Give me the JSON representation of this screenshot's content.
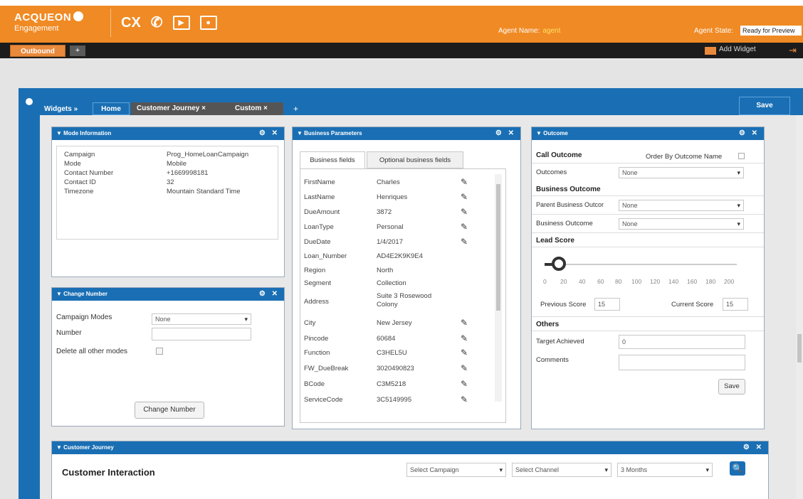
{
  "header": {
    "logo_line1": "ACQUEON",
    "logo_line2": "Engagement",
    "cx_label": "CX",
    "agent_name_label": "Agent Name:",
    "agent_name_value": "agent",
    "agent_state_label": "Agent State:",
    "agent_state_value": "Ready for Preview"
  },
  "tabbar": {
    "active_tab": "Outbound",
    "add_tab": "+",
    "add_widget": "Add Widget"
  },
  "widgets_bar": {
    "label": "Widgets »",
    "tabs": [
      {
        "label": "Home"
      },
      {
        "label": "Customer Journey ×"
      },
      {
        "label": "Custom ×"
      }
    ],
    "plus": "+",
    "save": "Save"
  },
  "mode_info": {
    "title": "▼ Mode Information",
    "controls": "⚙ ✕",
    "rows": [
      {
        "key": "Campaign",
        "value": "Prog_HomeLoanCampaign"
      },
      {
        "key": "Mode",
        "value": "Mobile"
      },
      {
        "key": "Contact Number",
        "value": "+1669998181"
      },
      {
        "key": "Contact ID",
        "value": "32"
      },
      {
        "key": "Timezone",
        "value": "Mountain Standard Time"
      }
    ]
  },
  "change_number": {
    "title": "▼ Change Number",
    "controls": "⚙ ✕",
    "campaign_modes_label": "Campaign Modes",
    "campaign_modes_value": "None",
    "number_label": "Number",
    "number_value": "",
    "delete_label": "Delete all other modes",
    "button": "Change Number"
  },
  "business_params": {
    "title": "▼ Business Parameters",
    "controls": "⚙ ✕",
    "tab1": "Business fields",
    "tab2": "Optional business fields",
    "rows": [
      {
        "key": "FirstName",
        "value": "Charles",
        "edit": "✎"
      },
      {
        "key": "LastName",
        "value": "Henriques",
        "edit": "✎"
      },
      {
        "key": "DueAmount",
        "value": "3872",
        "edit": "✎"
      },
      {
        "key": "LoanType",
        "value": "Personal",
        "edit": "✎"
      },
      {
        "key": "DueDate",
        "value": "1/4/2017",
        "edit": "✎"
      },
      {
        "key": "Loan_Number",
        "value": "AD4E2K9K9E4",
        "edit": ""
      },
      {
        "key": "Region",
        "value": "North",
        "edit": ""
      },
      {
        "key": "Segment",
        "value": "Collection",
        "edit": ""
      },
      {
        "key": "Address",
        "value": "Suite 3 Rosewood Colony",
        "edit": ""
      },
      {
        "key": "City",
        "value": "New Jersey",
        "edit": "✎"
      },
      {
        "key": "Pincode",
        "value": "60684",
        "edit": "✎"
      },
      {
        "key": "Function",
        "value": "C3HEL5U",
        "edit": "✎"
      },
      {
        "key": "FW_DueBreak",
        "value": "3020490823",
        "edit": "✎"
      },
      {
        "key": "BCode",
        "value": "C3M5218",
        "edit": "✎"
      },
      {
        "key": "ServiceCode",
        "value": "3C5149995",
        "edit": "✎"
      }
    ]
  },
  "outcome": {
    "title": "▼ Outcome",
    "controls": "⚙ ✕",
    "call_outcome": "Call Outcome",
    "order_by": "Order By Outcome Name",
    "outcomes_label": "Outcomes",
    "outcomes_value": "None",
    "business_outcome": "Business Outcome",
    "parent_label": "Parent Business Outcor",
    "parent_value": "None",
    "bo_label": "Business Outcome",
    "bo_value": "None",
    "lead_score": "Lead Score",
    "lead_score_value": 0.02,
    "ticks": [
      "0",
      "20",
      "40",
      "60",
      "80",
      "100",
      "120",
      "140",
      "160",
      "180",
      "200"
    ],
    "previous_score_label": "Previous Score",
    "previous_score_value": "15",
    "current_score_label": "Current Score",
    "current_score_value": "15",
    "others": "Others",
    "target_label": "Target Achieved",
    "target_value": "0",
    "comments_label": "Comments",
    "comments_value": "",
    "save": "Save"
  },
  "customer_journey": {
    "title": "▼ Customer Journey",
    "controls": "⚙ ✕",
    "heading": "Customer Interaction",
    "campaign_select": "Select Campaign",
    "channel_select": "Select Channel",
    "period_select": "3 Months",
    "search": "🔍"
  }
}
